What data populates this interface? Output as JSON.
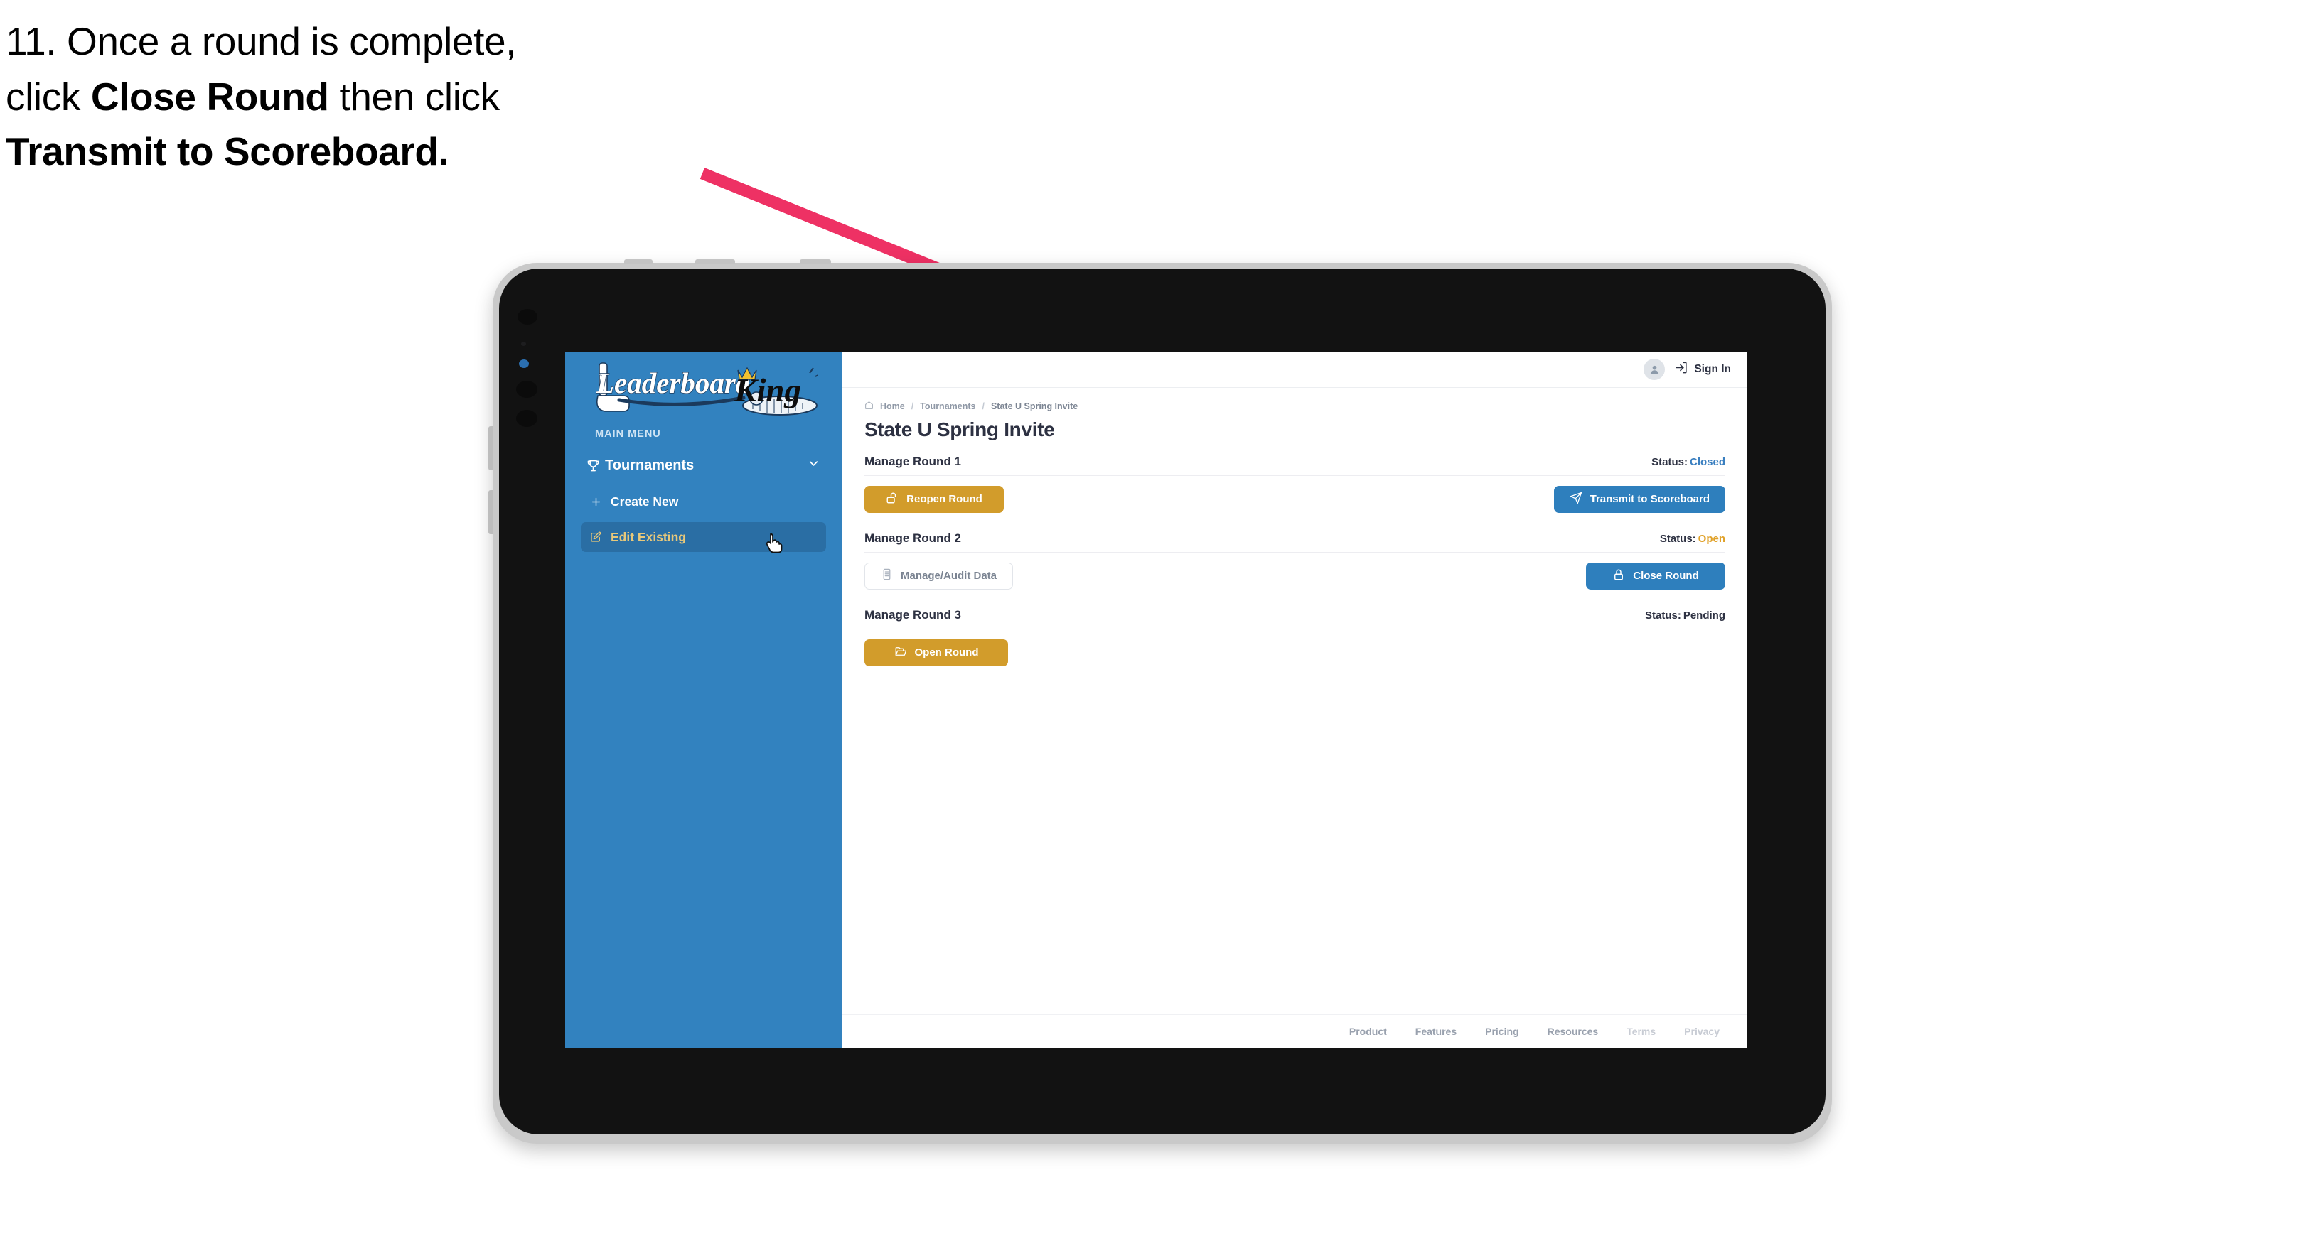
{
  "caption": {
    "line1_plain": "11. Once a round is complete,",
    "line2_pre": "click ",
    "line2_bold": "Close Round",
    "line2_post": " then click",
    "line3_bold": "Transmit to Scoreboard."
  },
  "colors": {
    "arrow": "#ee3164",
    "sidebar_blue": "#3282bf",
    "sidebar_active": "#2a6ea4",
    "sidebar_active_text": "#e8c87a",
    "primary_blue": "#2e7fbd",
    "gold": "#d29c2b",
    "status_closed": "#3a7fc0",
    "status_open": "#e0a128",
    "text_dark": "#2d3142",
    "device_body": "#121212",
    "device_edge": "#c9c9c9"
  },
  "sidebar": {
    "logo_main": "Leaderboard",
    "logo_accent": "King",
    "menu_label": "MAIN MENU",
    "nav_root": {
      "label": "Tournaments",
      "icon": "trophy-icon",
      "chevron": "chevron-down-icon"
    },
    "items": [
      {
        "label": "Create New",
        "icon": "plus-icon",
        "active": false
      },
      {
        "label": "Edit Existing",
        "icon": "edit-pencil-icon",
        "active": true
      }
    ]
  },
  "topbar": {
    "avatar_icon": "user-avatar-icon",
    "signin_icon": "sign-in-arrow-icon",
    "signin_label": "Sign In"
  },
  "breadcrumb": {
    "home_icon": "home-icon",
    "items": [
      "Home",
      "Tournaments",
      "State U Spring Invite"
    ],
    "separator": "/"
  },
  "page": {
    "title": "State U Spring Invite"
  },
  "rounds": [
    {
      "title": "Manage Round 1",
      "status_label": "Status:",
      "status_value": "Closed",
      "status_class": "st-closed",
      "left_button": {
        "label": "Reopen Round",
        "icon": "unlock-icon",
        "style": "btn-gold"
      },
      "right_button": {
        "label": "Transmit to Scoreboard",
        "icon": "paper-plane-icon",
        "style": "btn-blue"
      }
    },
    {
      "title": "Manage Round 2",
      "status_label": "Status:",
      "status_value": "Open",
      "status_class": "st-open",
      "left_button": {
        "label": "Manage/Audit Data",
        "icon": "clipboard-icon",
        "style": "btn-ghost"
      },
      "right_button": {
        "label": "Close Round",
        "icon": "lock-icon",
        "style": "btn-blue"
      }
    },
    {
      "title": "Manage Round 3",
      "status_label": "Status:",
      "status_value": "Pending",
      "status_class": "st-pending",
      "left_button": {
        "label": "Open Round",
        "icon": "folder-open-icon",
        "style": "btn-gold"
      },
      "right_button": null
    }
  ],
  "footer": {
    "links": [
      {
        "label": "Product",
        "dim": false
      },
      {
        "label": "Features",
        "dim": false
      },
      {
        "label": "Pricing",
        "dim": false
      },
      {
        "label": "Resources",
        "dim": false
      },
      {
        "label": "Terms",
        "dim": true
      },
      {
        "label": "Privacy",
        "dim": true
      }
    ]
  }
}
